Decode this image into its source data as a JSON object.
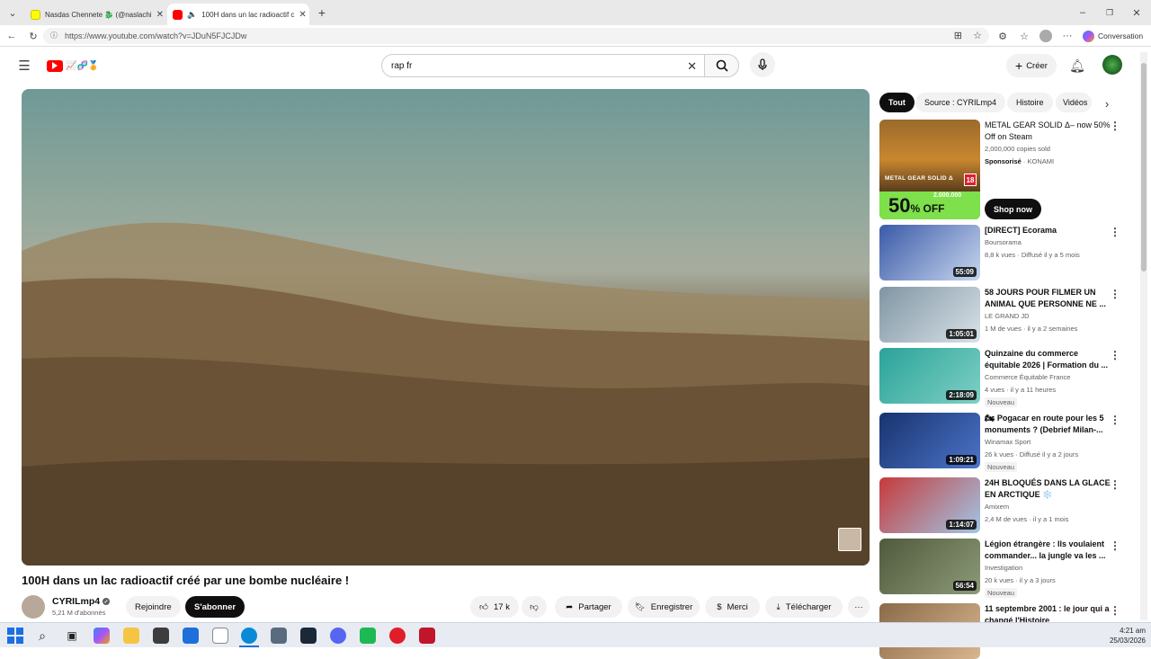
{
  "browser": {
    "tabs": [
      {
        "title": "Nasdas Chennete 🐉 (@naslachi",
        "active": false
      },
      {
        "title": "100H dans un lac radioactif c",
        "active": true
      }
    ],
    "url": "https://www.youtube.com/watch?v=JDuN5FJCJDw",
    "conversation_label": "Conversation"
  },
  "youtube": {
    "logo_text": "📈🧬🏅",
    "search_value": "rap fr",
    "create_label": "Créer"
  },
  "video": {
    "title": "100H dans un lac radioactif créé par une bombe nucléaire !",
    "channel": "CYRILmp4",
    "subscribers": "5,21 M d'abonnés",
    "join_label": "Rejoindre",
    "subscribe_label": "S'abonner",
    "likes": "17 k",
    "share_label": "Partager",
    "save_label": "Enregistrer",
    "thanks_label": "Merci",
    "download_label": "Télécharger"
  },
  "filters": [
    "Tout",
    "Source : CYRILmp4",
    "Histoire",
    "Vidéos"
  ],
  "ad": {
    "title": "METAL GEAR SOLID Δ– now 50% Off on Steam",
    "meta": "2,000,000 copies sold",
    "sponsored": "Sponsorisé",
    "advertiser": "KONAMI",
    "cta": "Shop now",
    "thumb_game": "METAL GEAR SOLID Δ",
    "thumb_rating": "18",
    "thumb_discount": "50",
    "thumb_off": "% OFF",
    "thumb_copies": "2.000.000"
  },
  "related": [
    {
      "title": "[DIRECT] Ecorama",
      "channel": "Boursorama",
      "meta": "8,8 k vues · Diffusé il y a 5 mois",
      "duration": "55:09",
      "badge": "",
      "thumb_colors": [
        "#3a5aa8",
        "#c8d6ef"
      ]
    },
    {
      "title": "58 JOURS POUR FILMER UN ANIMAL QUE PERSONNE NE ...",
      "channel": "LE GRAND JD",
      "meta": "1 M de vues · il y a 2 semaines",
      "duration": "1:05:01",
      "badge": "",
      "thumb_colors": [
        "#7f95a3",
        "#d9e2e8"
      ]
    },
    {
      "title": "Quinzaine du commerce équitable 2026 | Formation du ...",
      "channel": "Commerce Équitable France",
      "meta": "4 vues · il y a 11 heures",
      "duration": "2:18:09",
      "badge": "Nouveau",
      "thumb_colors": [
        "#2aa39a",
        "#7fd0c4"
      ]
    },
    {
      "title": "🏍 Pogacar en route pour les 5 monuments ? (Debrief Milan-...",
      "channel": "Winamax Sport",
      "meta": "26 k vues · Diffusé il y a 2 jours",
      "duration": "1:09:21",
      "badge": "Nouveau",
      "thumb_colors": [
        "#18336e",
        "#4c74c9"
      ]
    },
    {
      "title": "24H BLOQUÉS DANS LA GLACE EN ARCTIQUE ❄️",
      "channel": "Amixem",
      "meta": "2,4 M de vues · il y a 1 mois",
      "duration": "1:14:07",
      "badge": "",
      "thumb_colors": [
        "#c73a3a",
        "#9fc7e8"
      ]
    },
    {
      "title": "Légion étrangère : Ils voulaient commander... la jungle va les ...",
      "channel": "Investigation",
      "meta": "20 k vues · il y a 3 jours",
      "duration": "56:54",
      "badge": "Nouveau",
      "thumb_colors": [
        "#4f5a3c",
        "#8d9a78"
      ]
    },
    {
      "title": "11 septembre 2001 : le jour qui a changé l'Histoire",
      "channel": "",
      "meta": "",
      "duration": "",
      "badge": "",
      "thumb_colors": [
        "#8a6a4a",
        "#d9b58f"
      ]
    }
  ],
  "taskbar": {
    "time": "4:21 am",
    "date": "25/03/2026"
  }
}
